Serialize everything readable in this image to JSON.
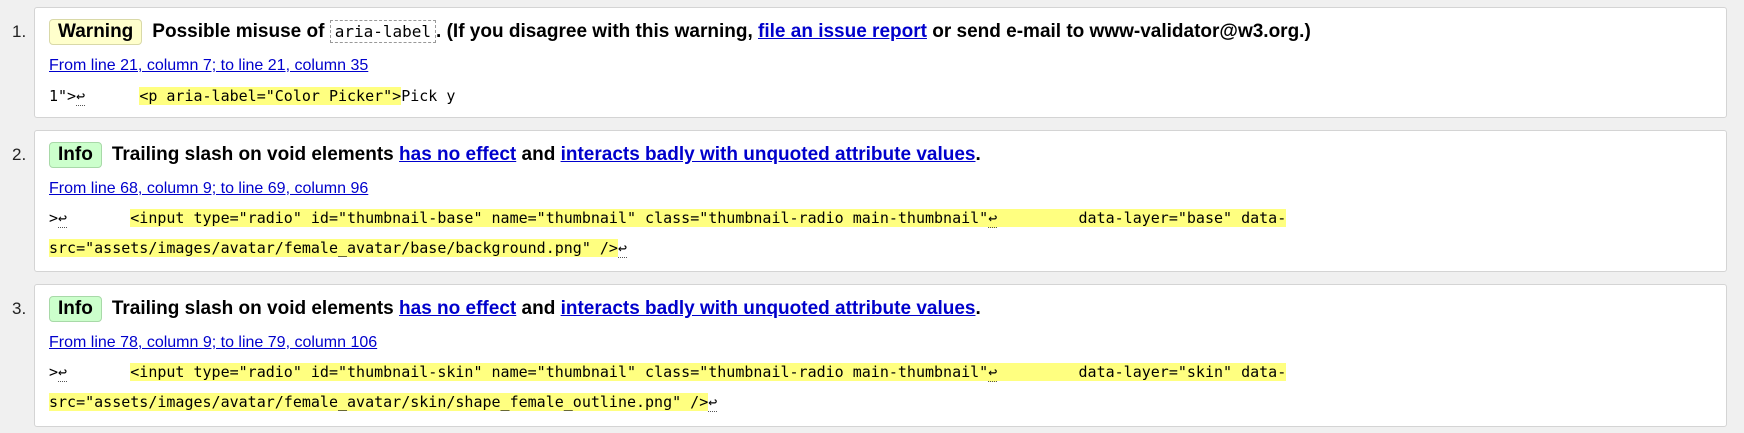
{
  "messages": [
    {
      "number": "1.",
      "type_label": "Warning",
      "text_before": "Possible misuse of",
      "code": "aria-label",
      "text_mid": ". (If you disagree with this warning,",
      "link1": "file an issue report",
      "text_after": "or send e-mail to www-validator@w3.org.)",
      "location": "From line 21, column 7; to line 21, column 35",
      "extract_pre": "1\">",
      "extract_lf1": "↩",
      "extract_gap": "      ",
      "extract_hl": "<p aria-label=\"Color Picker\">",
      "extract_post": "Pick y"
    },
    {
      "number": "2.",
      "type_label": "Info",
      "text_before": "Trailing slash on void elements",
      "link1": "has no effect",
      "text_mid": "and",
      "link2": "interacts badly with unquoted attribute values",
      "text_after": ".",
      "location": "From line 68, column 9; to line 69, column 96",
      "line1_pre": ">",
      "line1_lf": "↩",
      "line1_gap": "       ",
      "line1_hl": "<input type=\"radio\" id=\"thumbnail-base\" name=\"thumbnail\" class=\"thumbnail-radio main-thumbnail\"",
      "line1_lf2": "↩",
      "line1_hl2": "         data-layer=\"base\" data-",
      "line2_hl": "src=\"assets/images/avatar/female_avatar/base/background.png\" />",
      "line2_lf": "↩"
    },
    {
      "number": "3.",
      "type_label": "Info",
      "text_before": "Trailing slash on void elements",
      "link1": "has no effect",
      "text_mid": "and",
      "link2": "interacts badly with unquoted attribute values",
      "text_after": ".",
      "location": "From line 78, column 9; to line 79, column 106",
      "line1_pre": ">",
      "line1_lf": "↩",
      "line1_gap": "       ",
      "line1_hl": "<input type=\"radio\" id=\"thumbnail-skin\" name=\"thumbnail\" class=\"thumbnail-radio main-thumbnail\"",
      "line1_lf2": "↩",
      "line1_hl2": "         data-layer=\"skin\" data-",
      "line2_hl": "src=\"assets/images/avatar/female_avatar/skin/shape_female_outline.png\" />",
      "line2_lf": "↩"
    }
  ]
}
